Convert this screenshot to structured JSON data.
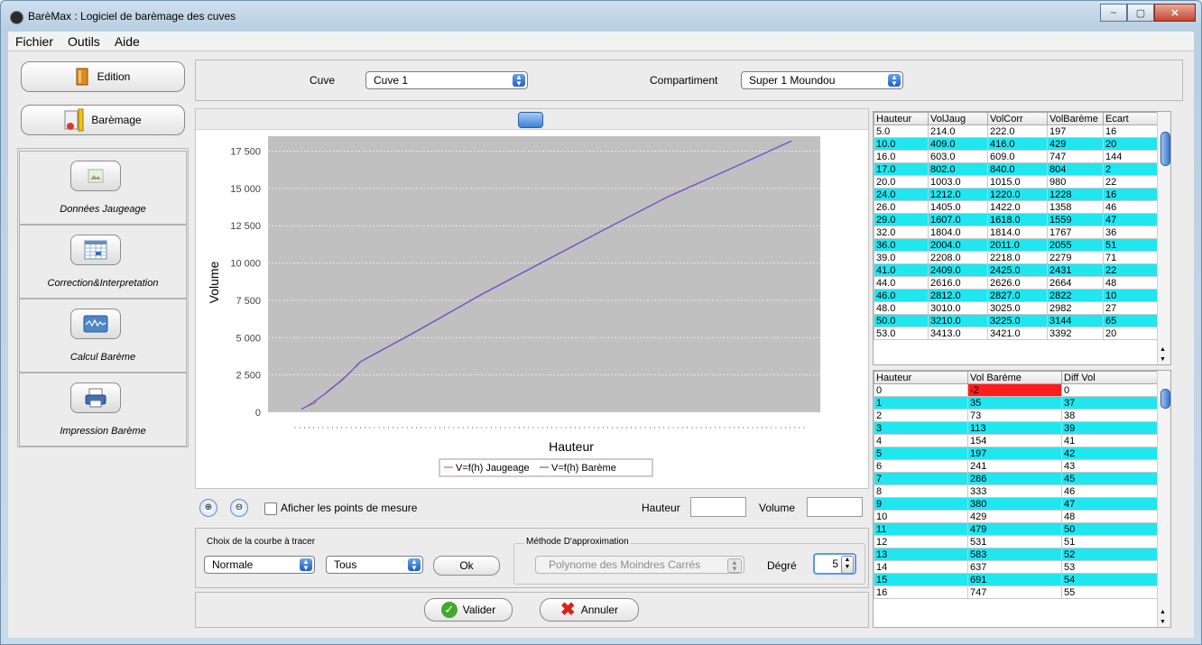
{
  "window": {
    "title": "BarèMax : Logiciel de barèmage des cuves",
    "minimize": "–",
    "maximize": "▢",
    "close": "✕"
  },
  "menu": [
    "Fichier",
    "Outils",
    "Aide"
  ],
  "sidebar": {
    "edition_label": "Edition",
    "baremage_label": "Barèmage",
    "items": [
      {
        "label": "Données Jaugeage",
        "icon": "image-icon"
      },
      {
        "label": "Correction&Interpretation",
        "icon": "calendar-grid-icon"
      },
      {
        "label": "Calcul Barème",
        "icon": "waveform-icon"
      },
      {
        "label": "Impression Barème",
        "icon": "printer-icon"
      }
    ]
  },
  "header": {
    "cuve_label": "Cuve",
    "cuve_value": "Cuve 1",
    "compartiment_label": "Compartiment",
    "compartiment_value": "Super 1 Moundou"
  },
  "chart": {
    "legend_jaugeage": "V=f(h) Jaugeage",
    "legend_bareme": "V=f(h) Barème",
    "color_jaugeage": "#e06060",
    "color_bareme": "#5a5ae6"
  },
  "chart_data": {
    "type": "line",
    "xlabel": "Hauteur",
    "ylabel": "Volume",
    "ylim": [
      0,
      18500
    ],
    "yticks": [
      "0",
      "2 500",
      "5 000",
      "7 500",
      "10 000",
      "12 500",
      "15 000",
      "17 500"
    ],
    "grid": true,
    "legend_position": "bottom",
    "series": [
      {
        "name": "V=f(h) Jaugeage",
        "x": [
          5,
          10,
          16,
          17,
          20,
          24,
          26,
          29,
          32,
          36,
          39,
          41,
          44,
          46,
          48,
          50,
          53,
          100,
          150,
          200,
          250,
          300,
          350,
          400
        ],
        "values": [
          214,
          409,
          603,
          802,
          1003,
          1212,
          1405,
          1607,
          1804,
          2004,
          2208,
          2409,
          2616,
          2812,
          3010,
          3210,
          3413,
          5550,
          7900,
          10100,
          12300,
          14450,
          16300,
          18200
        ]
      },
      {
        "name": "V=f(h) Barème",
        "x": [
          5,
          10,
          16,
          17,
          20,
          24,
          26,
          29,
          32,
          36,
          39,
          41,
          44,
          46,
          48,
          50,
          53,
          100,
          150,
          200,
          250,
          300,
          350,
          400
        ],
        "values": [
          197,
          429,
          747,
          804,
          980,
          1228,
          1358,
          1559,
          1767,
          2055,
          2279,
          2431,
          2664,
          2822,
          2982,
          3144,
          3392,
          5520,
          7880,
          10080,
          12270,
          14420,
          16280,
          18180
        ]
      }
    ]
  },
  "controls": {
    "afficher_label": "Aficher les points de mesure",
    "hauteur_label": "Hauteur",
    "hauteur_value": "",
    "volume_label": "Volume",
    "volume_value": ""
  },
  "choix": {
    "group_label": "Choix de la courbe à tracer",
    "type_value": "Normale",
    "filter_value": "Tous",
    "ok_label": "Ok"
  },
  "methode": {
    "group_label": "Méthode D'approximation",
    "value": "Polynome des Moindres Carrés",
    "degre_label": "Dégré",
    "degre_value": "5"
  },
  "actions": {
    "valider": "Valider",
    "annuler": "Annuler"
  },
  "table1": {
    "headers": [
      "Hauteur",
      "VolJaug",
      "VolCorr",
      "VolBarème",
      "Ecart"
    ],
    "rows": [
      [
        "5.0",
        "214.0",
        "222.0",
        "197",
        "16"
      ],
      [
        "10.0",
        "409.0",
        "416.0",
        "429",
        "20"
      ],
      [
        "16.0",
        "603.0",
        "609.0",
        "747",
        "144"
      ],
      [
        "17.0",
        "802.0",
        "840.0",
        "804",
        "2"
      ],
      [
        "20.0",
        "1003.0",
        "1015.0",
        "980",
        "22"
      ],
      [
        "24.0",
        "1212.0",
        "1220.0",
        "1228",
        "16"
      ],
      [
        "26.0",
        "1405.0",
        "1422.0",
        "1358",
        "46"
      ],
      [
        "29.0",
        "1607.0",
        "1618.0",
        "1559",
        "47"
      ],
      [
        "32.0",
        "1804.0",
        "1814.0",
        "1767",
        "36"
      ],
      [
        "36.0",
        "2004.0",
        "2011.0",
        "2055",
        "51"
      ],
      [
        "39.0",
        "2208.0",
        "2218.0",
        "2279",
        "71"
      ],
      [
        "41.0",
        "2409.0",
        "2425.0",
        "2431",
        "22"
      ],
      [
        "44.0",
        "2616.0",
        "2626.0",
        "2664",
        "48"
      ],
      [
        "46.0",
        "2812.0",
        "2827.0",
        "2822",
        "10"
      ],
      [
        "48.0",
        "3010.0",
        "3025.0",
        "2982",
        "27"
      ],
      [
        "50.0",
        "3210.0",
        "3225.0",
        "3144",
        "65"
      ],
      [
        "53.0",
        "3413.0",
        "3421.0",
        "3392",
        "20"
      ]
    ]
  },
  "table2": {
    "headers": [
      "Hauteur",
      "Vol Barème",
      "Diff Vol"
    ],
    "rows": [
      [
        "0",
        "-2",
        "0"
      ],
      [
        "1",
        "35",
        "37"
      ],
      [
        "2",
        "73",
        "38"
      ],
      [
        "3",
        "113",
        "39"
      ],
      [
        "4",
        "154",
        "41"
      ],
      [
        "5",
        "197",
        "42"
      ],
      [
        "6",
        "241",
        "43"
      ],
      [
        "7",
        "286",
        "45"
      ],
      [
        "8",
        "333",
        "46"
      ],
      [
        "9",
        "380",
        "47"
      ],
      [
        "10",
        "429",
        "48"
      ],
      [
        "11",
        "479",
        "50"
      ],
      [
        "12",
        "531",
        "51"
      ],
      [
        "13",
        "583",
        "52"
      ],
      [
        "14",
        "637",
        "53"
      ],
      [
        "15",
        "691",
        "54"
      ],
      [
        "16",
        "747",
        "55"
      ]
    ]
  }
}
